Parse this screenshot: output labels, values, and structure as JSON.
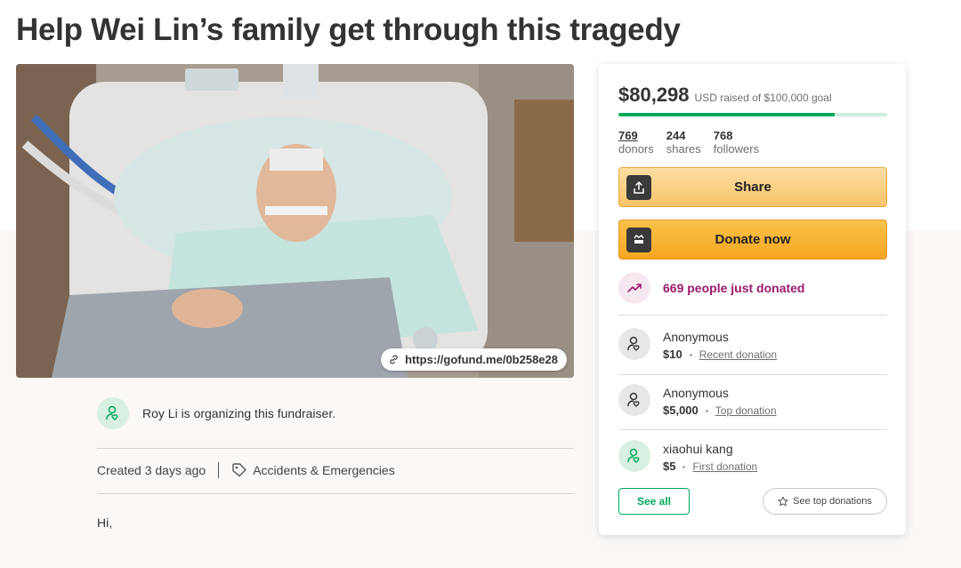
{
  "page": {
    "title": "Help Wei Lin’s family get through this tragedy"
  },
  "photo": {
    "url_label": "https://gofund.me/0b258e28"
  },
  "organizer": {
    "text": "Roy Li is organizing this fundraiser."
  },
  "meta": {
    "created": "Created 3 days ago",
    "category": "Accidents & Emergencies"
  },
  "story": {
    "first_line": "Hi,"
  },
  "card": {
    "raised_amount": "$80,298",
    "goal_text": "USD raised of $100,000 goal",
    "progress_fraction": 0.803,
    "stats": [
      {
        "num": "769",
        "label": "donors"
      },
      {
        "num": "244",
        "label": "shares"
      },
      {
        "num": "768",
        "label": "followers"
      }
    ],
    "share_label": "Share",
    "donate_label": "Donate now",
    "just_donated": "669 people just donated",
    "donations": [
      {
        "name": "Anonymous",
        "amount": "$10",
        "type": "Recent donation"
      },
      {
        "name": "Anonymous",
        "amount": "$5,000",
        "type": "Top donation"
      },
      {
        "name": "xiaohui kang",
        "amount": "$5",
        "type": "First donation"
      }
    ],
    "see_all_label": "See all",
    "see_top_label": "See top donations"
  },
  "colors": {
    "brand_green": "#02a95c",
    "accent_purple": "#9b1a6d",
    "donate_orange": "#f6a622"
  }
}
